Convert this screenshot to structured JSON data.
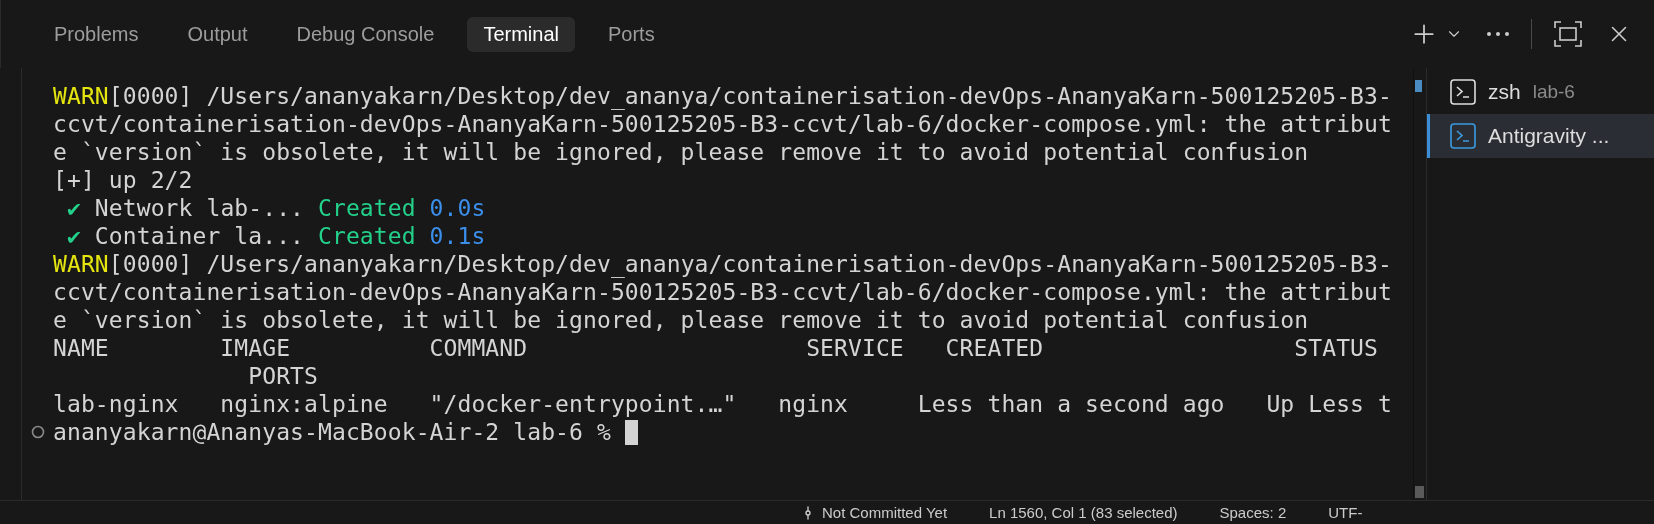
{
  "tabs": [
    {
      "label": "Problems",
      "selected": false
    },
    {
      "label": "Output",
      "selected": false
    },
    {
      "label": "Debug Console",
      "selected": false
    },
    {
      "label": "Terminal",
      "selected": true
    },
    {
      "label": "Ports",
      "selected": false
    }
  ],
  "terminal": {
    "lines": [
      {
        "segments": [
          {
            "kind": "warn",
            "text": "WARN"
          },
          {
            "kind": "plain",
            "text": "[0000] /Users/ananyakarn/Desktop/dev_ananya/containerisation-devOps-AnanyaKarn-500125205-B3-"
          }
        ]
      },
      {
        "segments": [
          {
            "kind": "plain",
            "text": "ccvt/containerisation-devOps-AnanyaKarn-500125205-B3-ccvt/lab-6/docker-compose.yml: the attribut"
          }
        ]
      },
      {
        "segments": [
          {
            "kind": "plain",
            "text": "e `version` is obsolete, it will be ignored, please remove it to avoid potential confusion"
          }
        ]
      },
      {
        "segments": [
          {
            "kind": "plain",
            "text": "[+] up 2/2"
          }
        ]
      },
      {
        "segments": [
          {
            "kind": "ok",
            "text": " ✔"
          },
          {
            "kind": "plain",
            "text": " Network lab-... "
          },
          {
            "kind": "ok",
            "text": "Created"
          },
          {
            "kind": "time",
            "text": " 0.0s"
          }
        ]
      },
      {
        "segments": [
          {
            "kind": "ok",
            "text": " ✔"
          },
          {
            "kind": "plain",
            "text": " Container la... "
          },
          {
            "kind": "ok",
            "text": "Created"
          },
          {
            "kind": "time",
            "text": " 0.1s"
          }
        ]
      },
      {
        "segments": [
          {
            "kind": "warn",
            "text": "WARN"
          },
          {
            "kind": "plain",
            "text": "[0000] /Users/ananyakarn/Desktop/dev_ananya/containerisation-devOps-AnanyaKarn-500125205-B3-"
          }
        ]
      },
      {
        "segments": [
          {
            "kind": "plain",
            "text": "ccvt/containerisation-devOps-AnanyaKarn-500125205-B3-ccvt/lab-6/docker-compose.yml: the attribut"
          }
        ]
      },
      {
        "segments": [
          {
            "kind": "plain",
            "text": "e `version` is obsolete, it will be ignored, please remove it to avoid potential confusion"
          }
        ]
      },
      {
        "segments": [
          {
            "kind": "plain",
            "text": "NAME        IMAGE          COMMAND                    SERVICE   CREATED                  STATUS"
          }
        ]
      },
      {
        "segments": [
          {
            "kind": "plain",
            "text": "              PORTS"
          }
        ]
      },
      {
        "segments": [
          {
            "kind": "plain",
            "text": "lab-nginx   nginx:alpine   \"/docker-entrypoint.…\"   nginx     Less than a second ago   Up Less t"
          }
        ]
      }
    ],
    "prompt": "ananyakarn@Ananyas-MacBook-Air-2 lab-6 %"
  },
  "terminals": [
    {
      "name": "zsh",
      "detail": "lab-6",
      "selected": false
    },
    {
      "name": "Antigravity ...",
      "selected": true
    }
  ],
  "status_bar": [
    "Not Committed Yet",
    "Ln 1560, Col 1 (83 selected)",
    "Spaces: 2",
    "UTF-"
  ]
}
